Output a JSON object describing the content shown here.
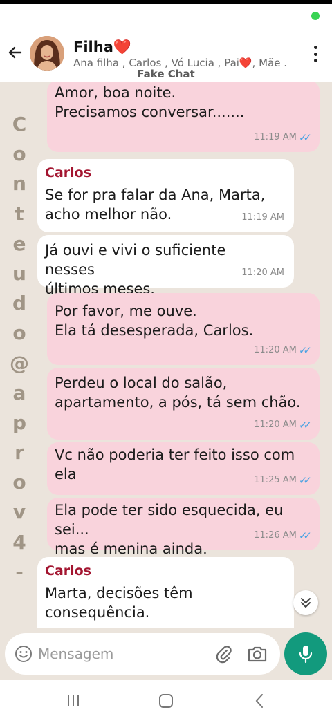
{
  "header": {
    "title": "Filha❤️",
    "subtitle": "Ana filha , Carlos , Vó Lucia , Pai❤️, Mãe ..",
    "fake_chat_label": "Fake Chat"
  },
  "watermark": {
    "letters": [
      "C",
      "o",
      "n",
      "t",
      "e",
      "u",
      "d",
      "o",
      "@",
      "a",
      "p",
      "r",
      "o",
      "v",
      "4",
      "-"
    ]
  },
  "messages": [
    {
      "direction": "out",
      "sender": "",
      "text": "Amor, boa noite.\nPrecisamos conversar.......",
      "time": "11:19 AM",
      "read": true
    },
    {
      "direction": "in",
      "sender": "Carlos",
      "text": "Se for pra falar da Ana, Marta,\nacho melhor não.",
      "time": "11:19 AM",
      "read": false
    },
    {
      "direction": "in",
      "sender": "",
      "text": "Já ouvi e vivi o suficiente nesses\núltimos meses.",
      "time": "11:20 AM",
      "read": false
    },
    {
      "direction": "out",
      "sender": "",
      "text": "Por favor, me ouve.\nEla tá desesperada, Carlos.",
      "time": "11:20 AM",
      "read": true
    },
    {
      "direction": "out",
      "sender": "",
      "text": "Perdeu o local do salão,\napartamento, a pós, tá sem chão.",
      "time": "11:20 AM",
      "read": true
    },
    {
      "direction": "out",
      "sender": "",
      "text": "Vc não poderia ter feito isso com\nela",
      "time": "11:25 AM",
      "read": true
    },
    {
      "direction": "out",
      "sender": "",
      "text": "Ela pode ter sido esquecida, eu sei...\nmas é menina ainda.",
      "time": "11:26 AM",
      "read": true
    },
    {
      "direction": "in",
      "sender": "Carlos",
      "text": "Marta, decisões têm\nconsequência.",
      "time": "",
      "read": false
    }
  ],
  "composer": {
    "placeholder": "Mensagem"
  },
  "colors": {
    "outgoing_bubble": "#f9d3dc",
    "incoming_bubble": "#ffffff",
    "sender_name": "#a31530",
    "chat_background": "#ebe4dc",
    "mic_button": "#129a7d",
    "read_ticks": "#4aa3e3"
  },
  "icons": {
    "back": "arrow-left-icon",
    "menu": "more-vertical-icon",
    "emoji": "emoji-icon",
    "attach": "paperclip-icon",
    "camera": "camera-icon",
    "mic": "mic-icon",
    "scroll": "double-chevron-down-icon"
  }
}
